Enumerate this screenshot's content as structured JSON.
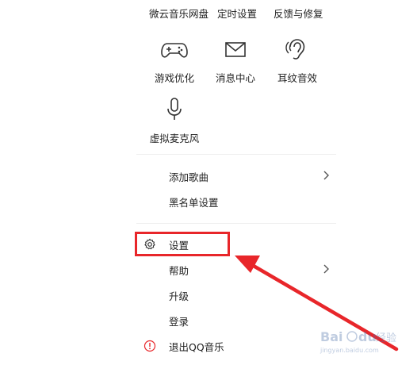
{
  "top_row": {
    "items": [
      {
        "label": "微云音乐网盘"
      },
      {
        "label": "定时设置"
      },
      {
        "label": "反馈与修复"
      }
    ]
  },
  "tools": [
    {
      "label": "游戏优化",
      "icon": "gamepad-icon"
    },
    {
      "label": "消息中心",
      "icon": "mail-icon"
    },
    {
      "label": "耳纹音效",
      "icon": "ear-icon"
    },
    {
      "label": "虚拟麦克风",
      "icon": "microphone-icon"
    }
  ],
  "menu": {
    "add_song": "添加歌曲",
    "blacklist": "黑名单设置",
    "settings": "设置",
    "help": "帮助",
    "upgrade": "升级",
    "login": "登录",
    "exit": "退出QQ音乐"
  },
  "colors": {
    "highlight": "#e8262a",
    "exit_icon": "#e8262a",
    "divider": "#eeeeee"
  },
  "watermark": {
    "brand": "Baidu经验",
    "url": "jingyan.baidu.com"
  }
}
